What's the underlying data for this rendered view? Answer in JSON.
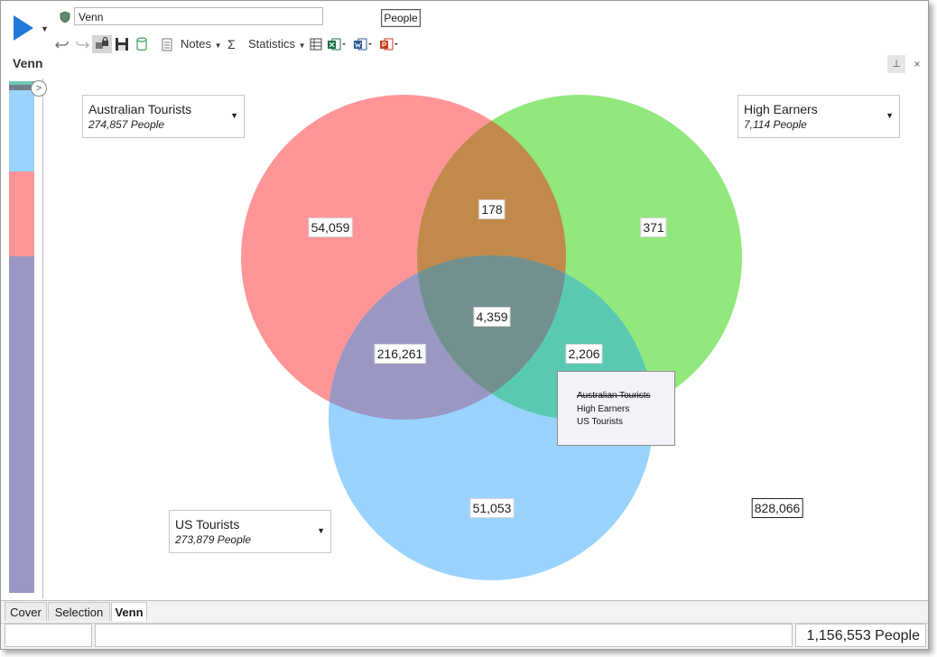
{
  "toolbar": {
    "title_value": "Venn",
    "people_label": "People",
    "notes_label": "Notes",
    "statistics_label": "Statistics"
  },
  "tab_title": "Venn",
  "venn": {
    "sets": [
      {
        "name": "Australian Tourists",
        "count": "274,857 People",
        "color": "#ff9597"
      },
      {
        "name": "High Earners",
        "count": "7,114 People",
        "color": "#92e87c"
      },
      {
        "name": "US Tourists",
        "count": "273,879 People",
        "color": "#99d3fe"
      }
    ],
    "regions": {
      "aus_only": "54,059",
      "aus_high": "178",
      "high_only": "371",
      "all_three": "4,359",
      "aus_us": "216,261",
      "high_us": "2,206",
      "us_only": "51,053",
      "outside": "828,066"
    },
    "region_colors": {
      "aus_high": "#c18a4c",
      "aus_us": "#9a97c3",
      "high_us": "#5ac9b2",
      "all_three": "#72908e"
    },
    "tooltip": {
      "line1": "Australian Tourists",
      "line2": "High Earners",
      "line3": "US Tourists"
    }
  },
  "strip_colors": {
    "top": "#6fc7b6",
    "dark": "#727d89",
    "blue": "#99d3fe",
    "red": "#ff9597",
    "purple": "#9a97c3"
  },
  "bottom_tabs": [
    "Cover",
    "Selection",
    "Venn"
  ],
  "status": {
    "total": "1,156,553 People"
  }
}
